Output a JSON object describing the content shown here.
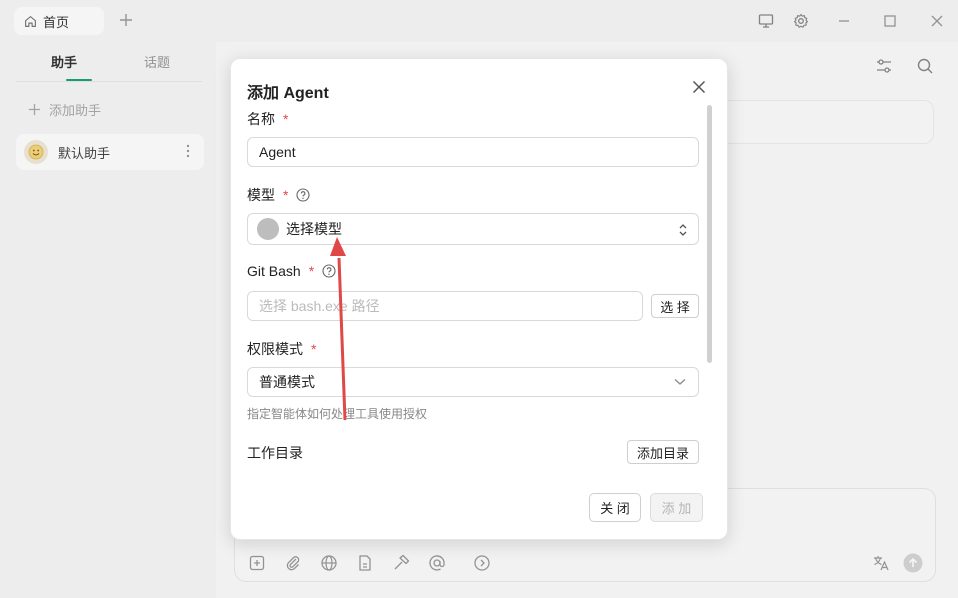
{
  "titlebar": {
    "tab_label": "首页",
    "icons": [
      "home-icon",
      "plus-icon",
      "monitor-icon",
      "gear-icon",
      "minimize-icon",
      "maximize-icon",
      "close-icon"
    ]
  },
  "sidebar": {
    "tabs": [
      {
        "label": "助手",
        "active": true
      },
      {
        "label": "话题",
        "active": false
      }
    ],
    "add_assistant_label": "添加助手",
    "assistants": [
      {
        "label": "默认助手"
      }
    ]
  },
  "modal": {
    "title": "添加 Agent",
    "name_label": "名称",
    "name_value": "Agent",
    "model_label": "模型",
    "model_value": "选择模型",
    "gitbash_label": "Git Bash",
    "gitbash_placeholder": "选择 bash.exe 路径",
    "select_button": "选 择",
    "permission_label": "权限模式",
    "permission_value": "普通模式",
    "permission_hint": "指定智能体如何处理工具使用授权",
    "workdir_label": "工作目录",
    "add_dir_button": "添加目录",
    "close_button": "关 闭",
    "add_button": "添 加",
    "required_mark": "*",
    "accent_required": "#e04a4a",
    "arrow_color": "#e04848"
  },
  "main": {
    "input_toolbar_icons": [
      "add-file-icon",
      "paperclip-icon",
      "globe-icon",
      "document-icon",
      "hammer-icon",
      "at-icon",
      "chevron-right-circle-icon"
    ],
    "header_icons": [
      "sliders-icon",
      "search-icon"
    ],
    "bottom_right_icons": [
      "translate-icon",
      "send-icon"
    ]
  }
}
